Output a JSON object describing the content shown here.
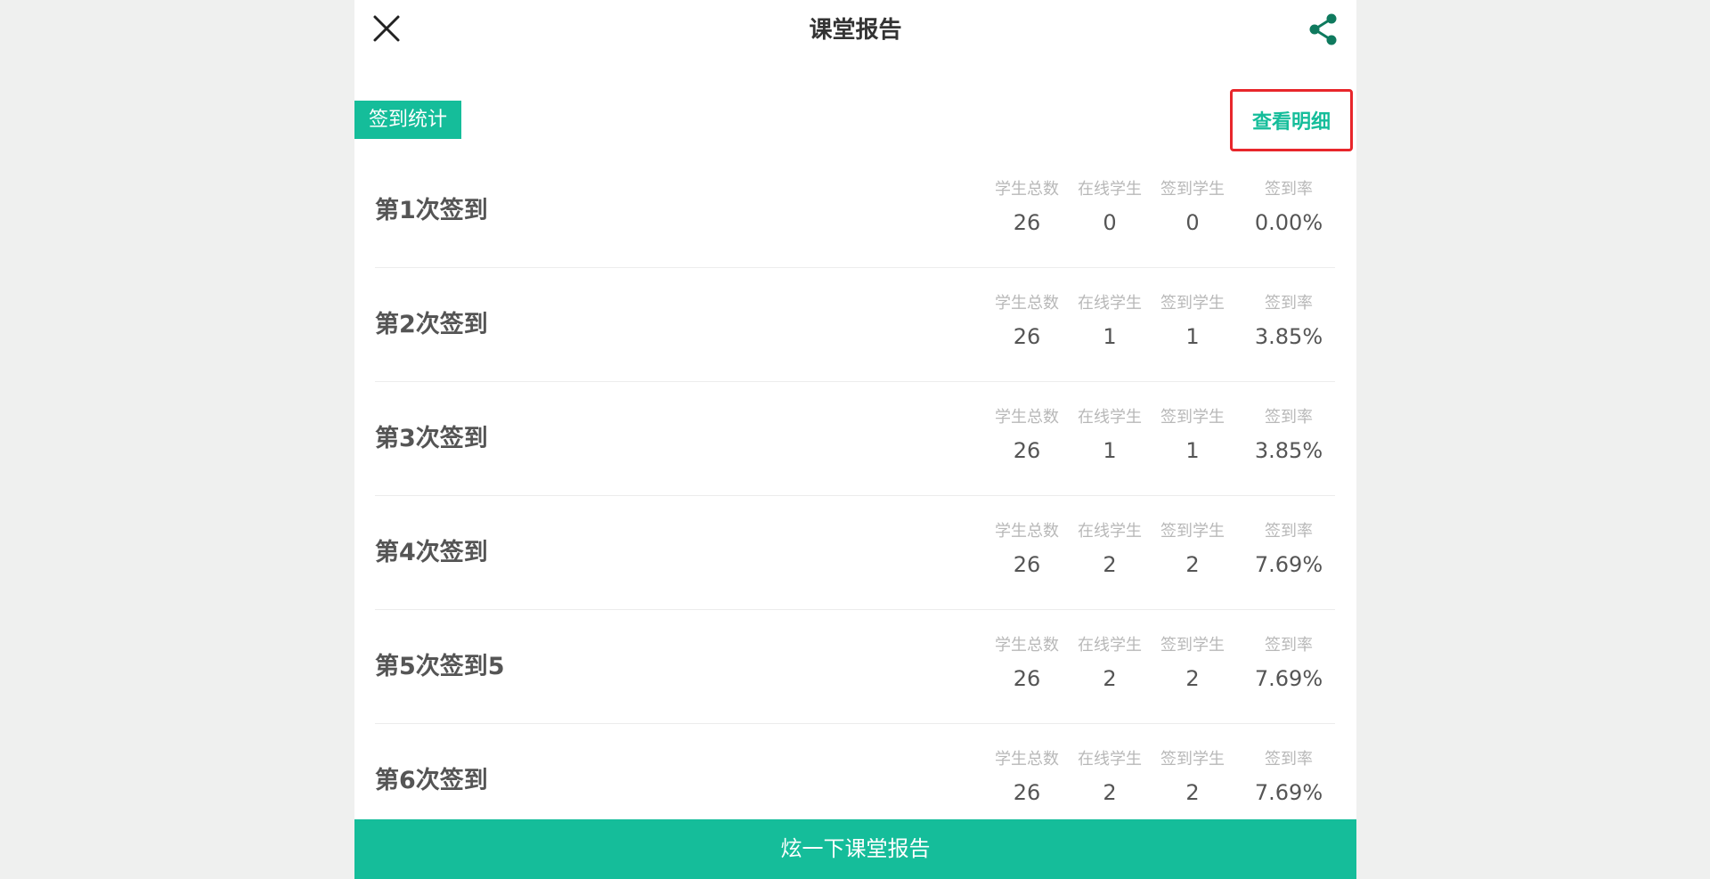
{
  "header": {
    "title": "课堂报告",
    "close_icon": "close-icon",
    "share_icon": "share-icon"
  },
  "section": {
    "tag": "签到统计",
    "detail_link": "查看明细"
  },
  "columns": {
    "total": "学生总数",
    "online": "在线学生",
    "signed": "签到学生",
    "rate": "签到率"
  },
  "rows": [
    {
      "title": "第1次签到",
      "total": "26",
      "online": "0",
      "signed": "0",
      "rate": "0.00%"
    },
    {
      "title": "第2次签到",
      "total": "26",
      "online": "1",
      "signed": "1",
      "rate": "3.85%"
    },
    {
      "title": "第3次签到",
      "total": "26",
      "online": "1",
      "signed": "1",
      "rate": "3.85%"
    },
    {
      "title": "第4次签到",
      "total": "26",
      "online": "2",
      "signed": "2",
      "rate": "7.69%"
    },
    {
      "title": "第5次签到5",
      "total": "26",
      "online": "2",
      "signed": "2",
      "rate": "7.69%"
    },
    {
      "title": "第6次签到",
      "total": "26",
      "online": "2",
      "signed": "2",
      "rate": "7.69%"
    }
  ],
  "footer": {
    "button_label": "炫一下课堂报告"
  },
  "colors": {
    "accent": "#15bd9a",
    "highlight_border": "#e8262b",
    "share_icon": "#0f7a5e"
  }
}
